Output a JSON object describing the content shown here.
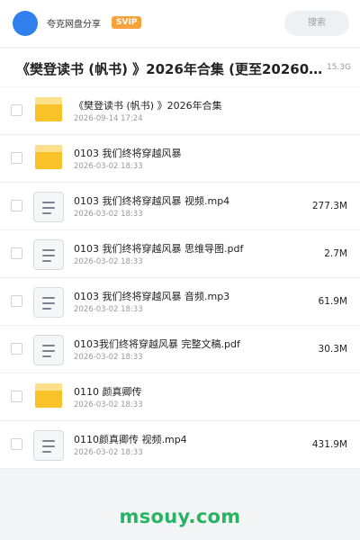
{
  "header": {
    "user_name": "夸克网盘分享",
    "badge": "SVIP",
    "search_label": "搜索"
  },
  "folder": {
    "title": "《樊登读书 (帆书) 》2026年合集 (更至20260912…",
    "more": "·",
    "size": "15.3G"
  },
  "files": [
    {
      "type": "folder",
      "name": "《樊登读书 (帆书) 》2026年合集",
      "date": "2026-09-14 17:24",
      "size": ""
    },
    {
      "type": "folder",
      "name": "0103 我们终将穿越风暴",
      "date": "2026-03-02 18:33",
      "size": ""
    },
    {
      "type": "file",
      "name": "0103 我们终将穿越风暴 视频.mp4",
      "date": "2026-03-02 18:33",
      "size": "277.3M"
    },
    {
      "type": "file",
      "name": "0103 我们终将穿越风暴 思维导图.pdf",
      "date": "2026-03-02 18:33",
      "size": "2.7M"
    },
    {
      "type": "file",
      "name": "0103 我们终将穿越风暴 音频.mp3",
      "date": "2026-03-02 18:33",
      "size": "61.9M"
    },
    {
      "type": "file",
      "name": "0103我们终将穿越风暴 完整文稿.pdf",
      "date": "2026-03-02 18:33",
      "size": "30.3M"
    },
    {
      "type": "folder",
      "name": "0110 颜真卿传",
      "date": "2026-03-02 18:33",
      "size": ""
    },
    {
      "type": "file",
      "name": "0110颜真卿传 视频.mp4",
      "date": "2026-03-02 18:33",
      "size": "431.9M"
    }
  ],
  "watermark": "msouy.com",
  "colors": {
    "accent": "#2f80ed",
    "svip": "#f7a23b",
    "folder": "#f8c228",
    "watermark": "#28b463"
  }
}
